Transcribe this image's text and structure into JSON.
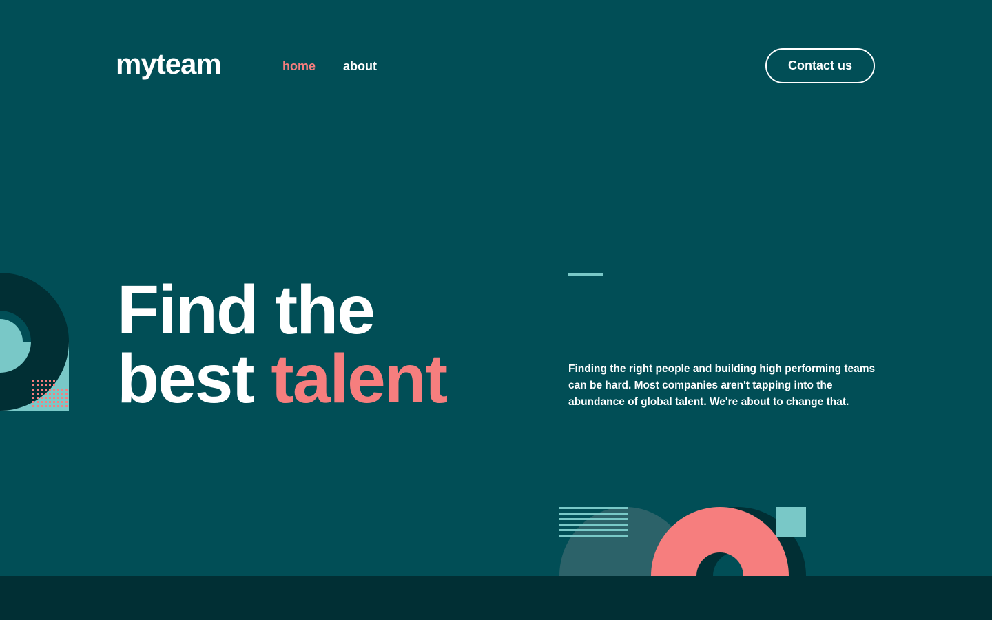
{
  "header": {
    "logo": "myteam",
    "nav": [
      {
        "label": "home",
        "active": true
      },
      {
        "label": "about",
        "active": false
      }
    ],
    "contact_label": "Contact us"
  },
  "hero": {
    "title_line1": "Find the",
    "title_line2_plain": "best",
    "title_line2_accent": "talent",
    "description": "Finding the right people and building high performing teams can be hard. Most companies aren't tapping into the abundance of global talent. We're about to change that."
  },
  "colors": {
    "background": "#014E56",
    "accent_coral": "#F67E7E",
    "accent_teal": "#79C8C7",
    "dark_teal": "#012F34",
    "text": "#FFFFFF"
  }
}
